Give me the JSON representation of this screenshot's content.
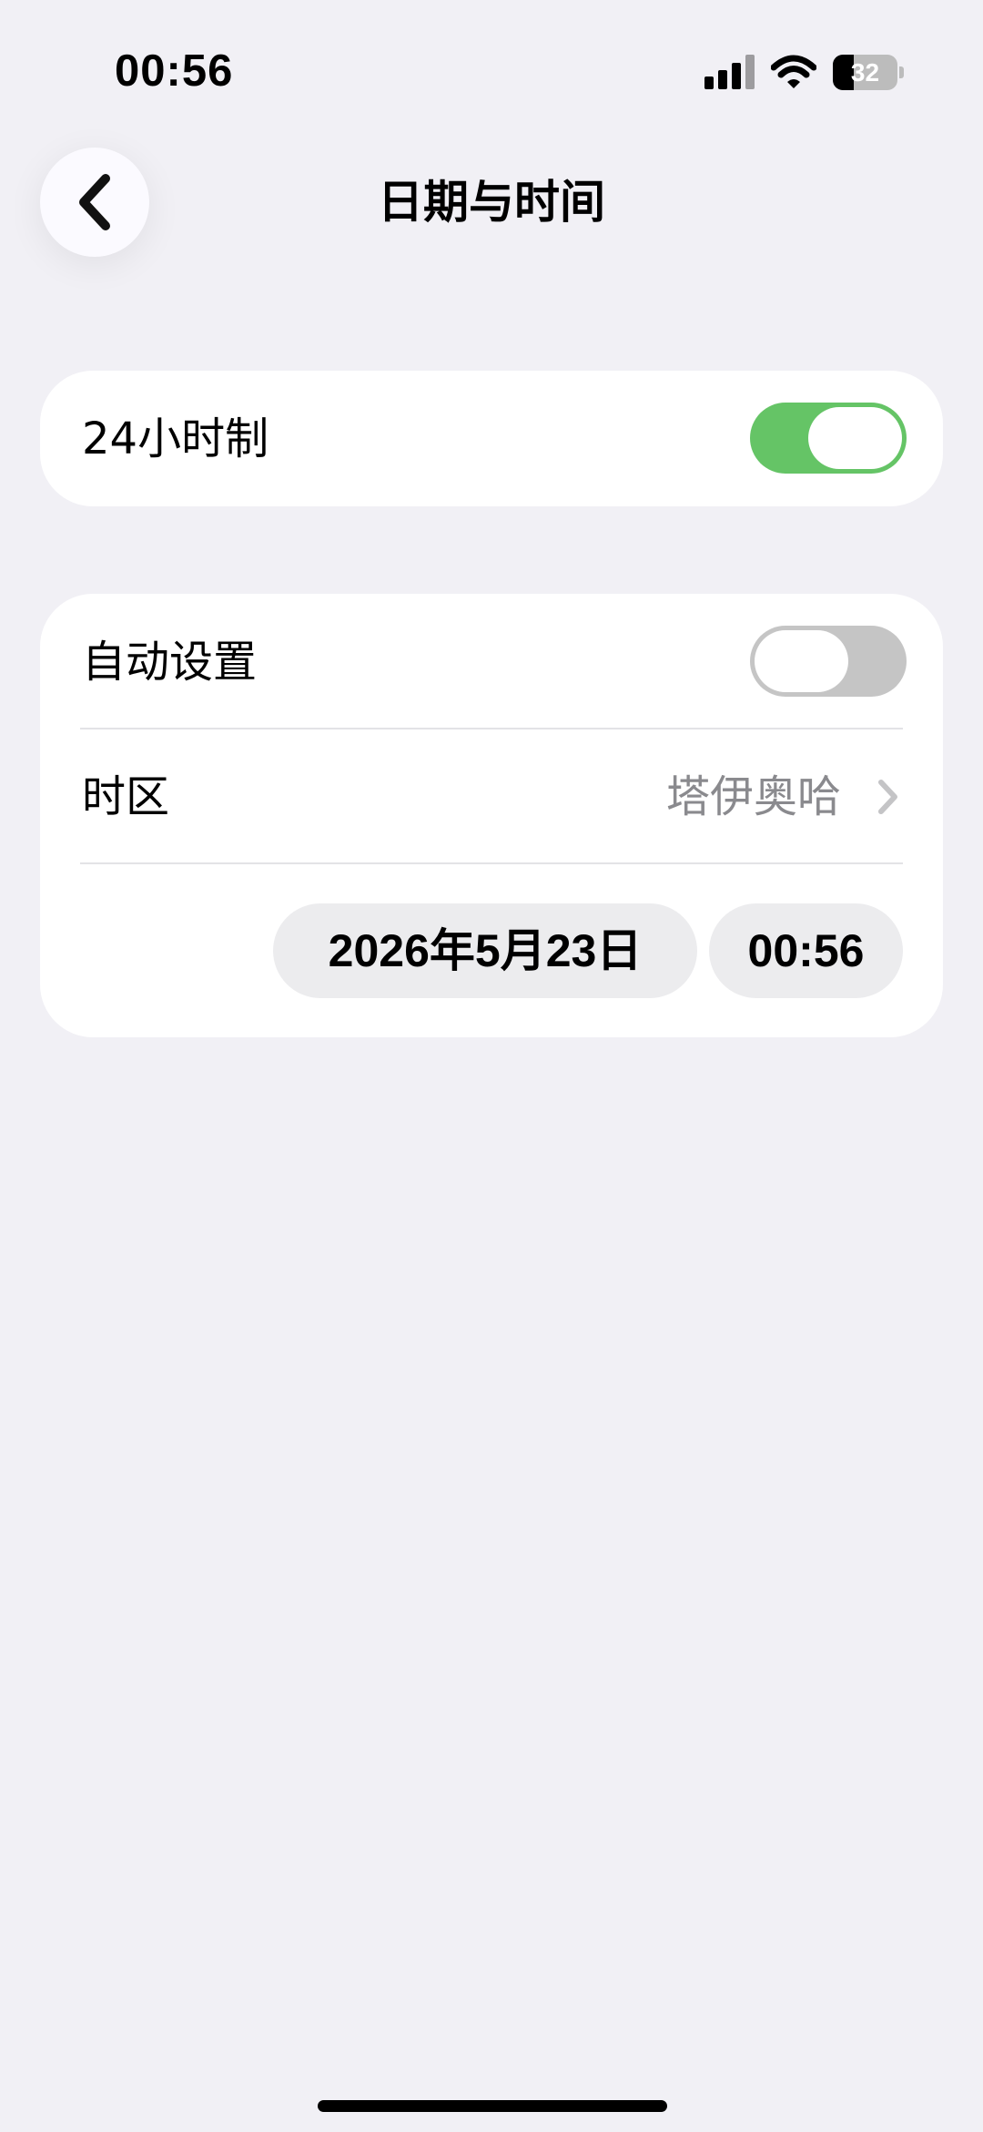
{
  "status_bar": {
    "time": "00:56",
    "battery_level": "32",
    "battery_fraction": 0.32,
    "icons": [
      "signal-icon",
      "wifi-icon",
      "battery-icon"
    ]
  },
  "nav": {
    "back_icon": "chevron-left-icon",
    "title": "日期与时间"
  },
  "settings": {
    "hour24": {
      "label": "24小时制",
      "enabled": true
    },
    "auto_set": {
      "label": "自动设置",
      "enabled": false
    },
    "timezone": {
      "label": "时区",
      "value": "塔伊奥哈"
    },
    "date_value": "2026年5月23日",
    "time_value": "00:56"
  },
  "colors": {
    "background": "#f1f0f5",
    "card": "#ffffff",
    "toggle_on": "#65c466",
    "toggle_off": "#c5c5c5",
    "secondary_text": "#8a8a8e",
    "pill": "#ececee"
  }
}
